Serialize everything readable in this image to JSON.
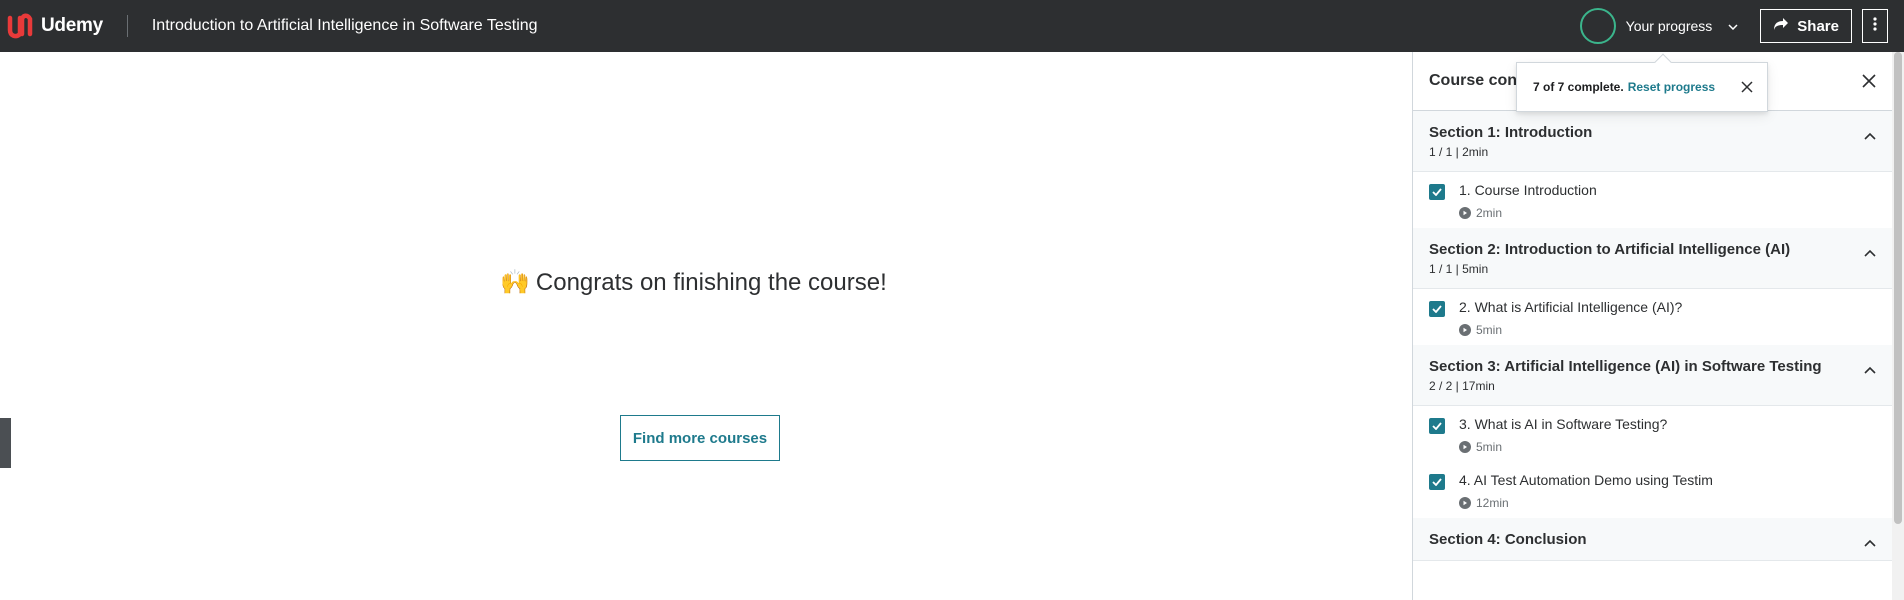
{
  "header": {
    "brand": "Udemy",
    "course_title": "Introduction to Artificial Intelligence in Software Testing",
    "progress_label": "Your progress",
    "share_label": "Share"
  },
  "main": {
    "congrats_emoji": "🙌",
    "congrats_text": "Congrats on finishing the course!",
    "find_courses_label": "Find more courses"
  },
  "popover": {
    "count_text": "7 of 7 complete.",
    "reset_label": "Reset progress"
  },
  "sidebar": {
    "title": "Course con",
    "sections": [
      {
        "title": "Section 1: Introduction",
        "meta": "1 / 1 | 2min",
        "lectures": [
          {
            "title": "1. Course Introduction",
            "duration": "2min",
            "checked": true
          }
        ]
      },
      {
        "title": "Section 2: Introduction to Artificial Intelligence (AI)",
        "meta": "1 / 1 | 5min",
        "lectures": [
          {
            "title": "2. What is Artificial Intelligence (AI)?",
            "duration": "5min",
            "checked": true
          }
        ]
      },
      {
        "title": "Section 3: Artificial Intelligence (AI) in Software Testing",
        "meta": "2 / 2 | 17min",
        "lectures": [
          {
            "title": "3. What is AI in Software Testing?",
            "duration": "5min",
            "checked": true
          },
          {
            "title": "4. AI Test Automation Demo using Testim",
            "duration": "12min",
            "checked": true
          }
        ]
      },
      {
        "title": "Section 4: Conclusion",
        "meta": "",
        "lectures": []
      }
    ]
  },
  "colors": {
    "header_bg": "#2d2f31",
    "accent_teal": "#1e7a8c",
    "progress_green": "#3bb58c",
    "brand_red": "#a435f0"
  }
}
